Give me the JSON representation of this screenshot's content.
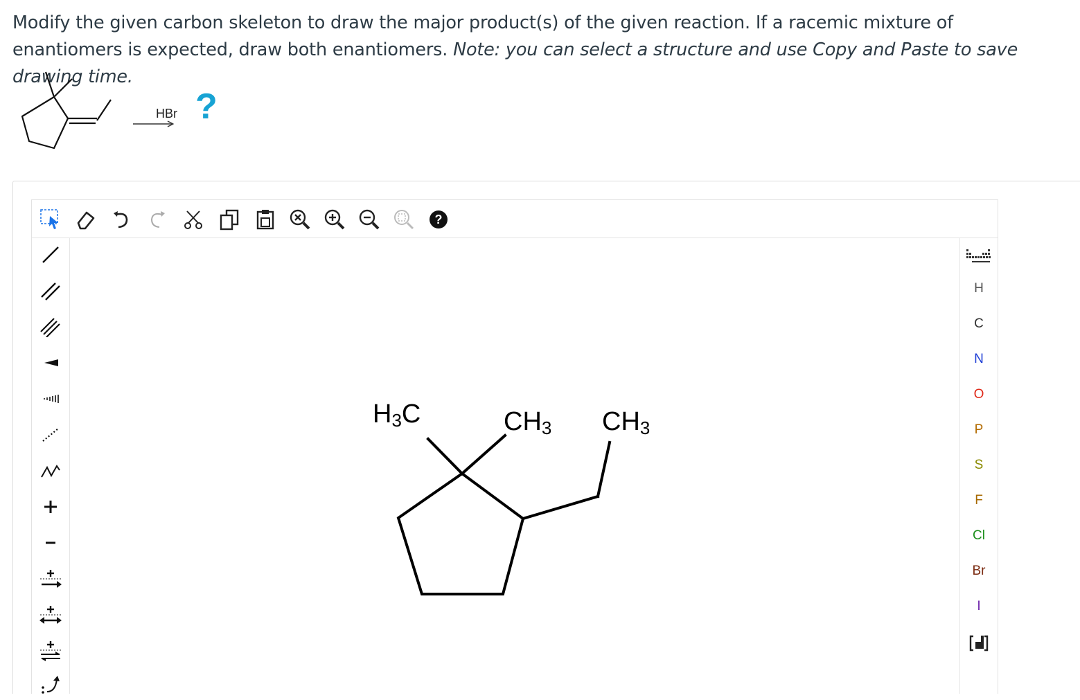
{
  "prompt": {
    "main": "Modify the given carbon skeleton to draw the major product(s) of the given reaction. If a racemic mixture of enantiomers is expected, draw both enantiomers.",
    "note": "Note: you can select a structure and use Copy and Paste to save drawing time."
  },
  "reaction": {
    "reagent": "HBr",
    "product_placeholder": "?",
    "arrow_color": "#333333",
    "question_color": "#17a3d4"
  },
  "toolbar_top": [
    {
      "name": "select-tool-icon",
      "active": true
    },
    {
      "name": "eraser-icon"
    },
    {
      "name": "undo-icon"
    },
    {
      "name": "redo-icon"
    },
    {
      "name": "cut-icon"
    },
    {
      "name": "copy-icon"
    },
    {
      "name": "paste-icon"
    },
    {
      "name": "zoom-clear-icon"
    },
    {
      "name": "zoom-in-icon"
    },
    {
      "name": "zoom-out-icon"
    },
    {
      "name": "zoom-fit-icon"
    },
    {
      "name": "help-icon"
    }
  ],
  "toolbar_left": [
    {
      "name": "single-bond-icon"
    },
    {
      "name": "double-bond-icon"
    },
    {
      "name": "triple-bond-icon"
    },
    {
      "name": "wedge-bond-icon"
    },
    {
      "name": "hash-bond-icon"
    },
    {
      "name": "dashed-bond-icon"
    },
    {
      "name": "chain-icon"
    },
    {
      "name": "positive-charge-icon"
    },
    {
      "name": "negative-charge-icon"
    },
    {
      "name": "reaction-arrow-icon"
    },
    {
      "name": "resonance-arrow-icon"
    },
    {
      "name": "equilibrium-arrow-icon"
    },
    {
      "name": "electron-arrow-icon"
    }
  ],
  "elements": [
    {
      "label": "H",
      "color": "#555555"
    },
    {
      "label": "C",
      "color": "#333333"
    },
    {
      "label": "N",
      "color": "#1f3fd6"
    },
    {
      "label": "O",
      "color": "#e02a1a"
    },
    {
      "label": "P",
      "color": "#b36b00"
    },
    {
      "label": "S",
      "color": "#8a8a00"
    },
    {
      "label": "F",
      "color": "#a86a00"
    },
    {
      "label": "Cl",
      "color": "#1c8f1c"
    },
    {
      "label": "Br",
      "color": "#7a2a10"
    },
    {
      "label": "I",
      "color": "#6a1ea8"
    }
  ],
  "canvas_labels": {
    "methyl_1": {
      "base": "H",
      "sub": "3",
      "end": "C"
    },
    "methyl_2": {
      "base": "CH",
      "sub": "3"
    },
    "methyl_3": {
      "base": "CH",
      "sub": "3"
    }
  }
}
